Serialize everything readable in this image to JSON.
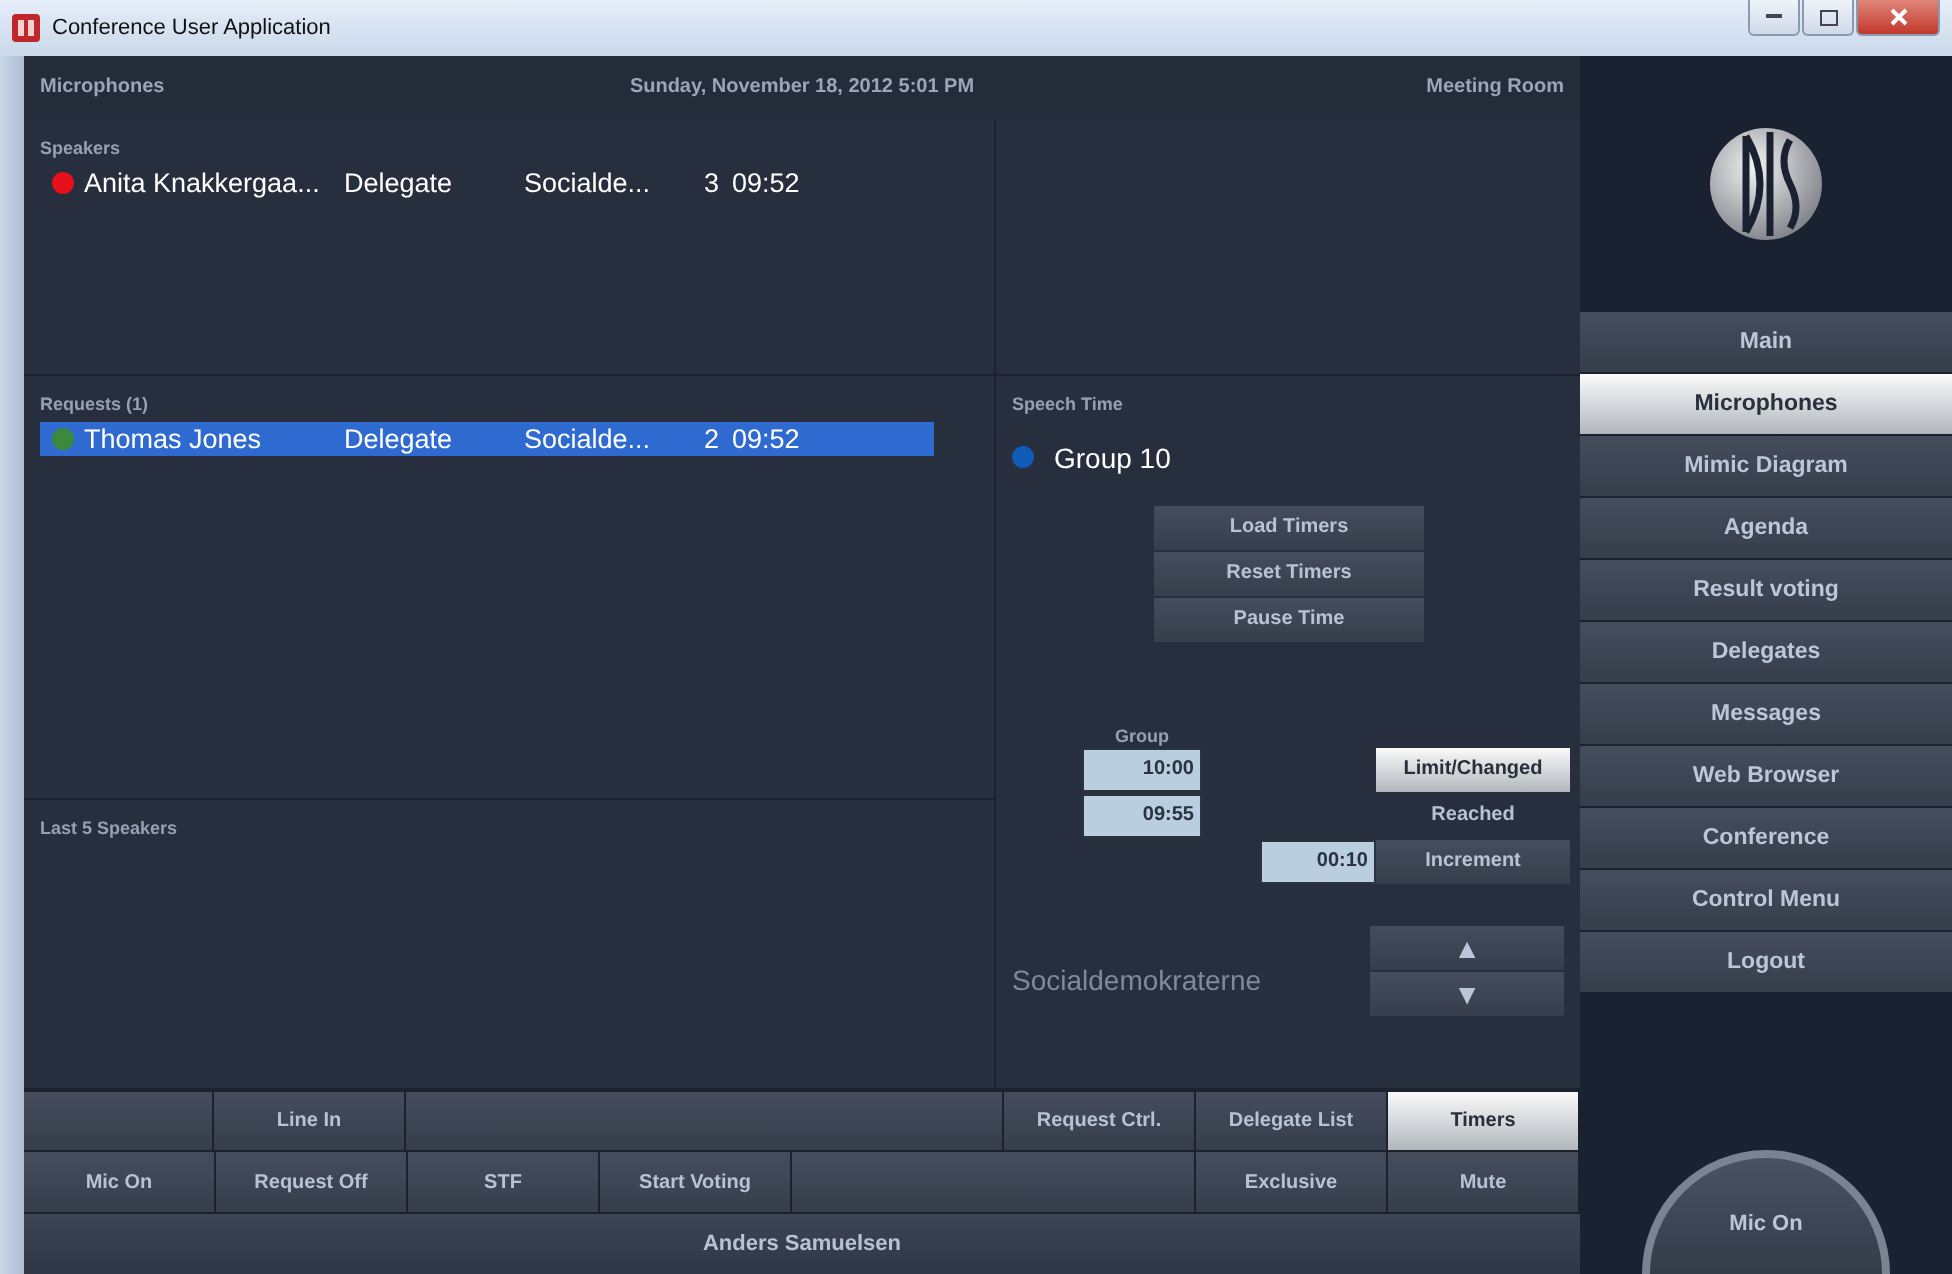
{
  "window": {
    "title": "Conference User Application"
  },
  "header": {
    "section": "Microphones",
    "datetime": "Sunday, November 18, 2012 5:01 PM",
    "room": "Meeting Room"
  },
  "speakers": {
    "title": "Speakers",
    "rows": [
      {
        "color": "#e8101a",
        "name": "Anita Knakkergaa...",
        "role": "Delegate",
        "party": "Socialde...",
        "seat": "3",
        "time": "09:52",
        "selected": false
      }
    ]
  },
  "requests": {
    "title": "Requests (1)",
    "rows": [
      {
        "color": "#3a8a3c",
        "name": "Thomas Jones",
        "role": "Delegate",
        "party": "Socialde...",
        "seat": "2",
        "time": "09:52",
        "selected": true
      }
    ]
  },
  "last_speakers": {
    "title": "Last 5 Speakers"
  },
  "speech_time": {
    "title": "Speech Time",
    "group": {
      "label": "Group 10",
      "color": "#0f5bb5"
    },
    "timer_buttons": [
      "Load Timers",
      "Reset Timers",
      "Pause Time"
    ],
    "group_label": "Group",
    "limit_value": "10:00",
    "reached_value": "09:55",
    "increment_value": "00:10",
    "mode_buttons": [
      {
        "label": "Limit/Changed",
        "kind": "button",
        "selected": true
      },
      {
        "label": "Reached",
        "kind": "label",
        "selected": false
      },
      {
        "label": "Increment",
        "kind": "button",
        "selected": false
      }
    ],
    "party": "Socialdemokraterne",
    "arrows": [
      "▲",
      "▼"
    ]
  },
  "button_rows": [
    [
      {
        "kind": "blank"
      },
      {
        "kind": "button",
        "label": "Line In",
        "selected": false
      },
      {
        "kind": "wide"
      },
      {
        "kind": "button",
        "label": "Request Ctrl.",
        "selected": false
      },
      {
        "kind": "button",
        "label": "Delegate List",
        "selected": false
      },
      {
        "kind": "button",
        "label": "Timers",
        "selected": true
      }
    ],
    [
      {
        "kind": "button",
        "label": "Mic On",
        "selected": false
      },
      {
        "kind": "button",
        "label": "Request Off",
        "selected": false
      },
      {
        "kind": "button",
        "label": "STF",
        "selected": false
      },
      {
        "kind": "button",
        "label": "Start Voting",
        "selected": false
      },
      {
        "kind": "wide"
      },
      {
        "kind": "button",
        "label": "Exclusive",
        "selected": false
      },
      {
        "kind": "button",
        "label": "Mute",
        "selected": false
      }
    ]
  ],
  "user": "Anders Samuelsen",
  "nav": [
    {
      "label": "Main",
      "selected": false
    },
    {
      "label": "Microphones",
      "selected": true
    },
    {
      "label": "Mimic Diagram",
      "selected": false
    },
    {
      "label": "Agenda",
      "selected": false
    },
    {
      "label": "Result voting",
      "selected": false
    },
    {
      "label": "Delegates",
      "selected": false
    },
    {
      "label": "Messages",
      "selected": false
    },
    {
      "label": "Web Browser",
      "selected": false
    },
    {
      "label": "Conference",
      "selected": false
    },
    {
      "label": "Control Menu",
      "selected": false
    },
    {
      "label": "Logout",
      "selected": false
    }
  ],
  "mic_button": "Mic On"
}
